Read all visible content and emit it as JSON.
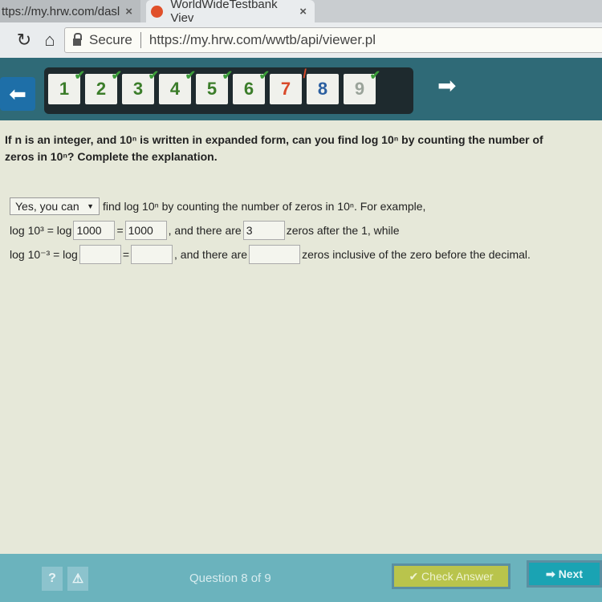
{
  "browser": {
    "tabs": [
      {
        "label": "ttps://my.hrw.com/dasl"
      },
      {
        "label": "WorldWideTestbank Viev"
      }
    ],
    "close_glyph": "×",
    "secure_label": "Secure",
    "url": "https://my.hrw.com/wwtb/api/viewer.pl"
  },
  "nav": {
    "back_glyph": "⬅",
    "forward_glyph": "➡",
    "questions": [
      {
        "num": "1",
        "state": "correct"
      },
      {
        "num": "2",
        "state": "correct"
      },
      {
        "num": "3",
        "state": "correct"
      },
      {
        "num": "4",
        "state": "correct"
      },
      {
        "num": "5",
        "state": "correct"
      },
      {
        "num": "6",
        "state": "correct"
      },
      {
        "num": "7",
        "state": "incorrect"
      },
      {
        "num": "8",
        "state": "current"
      },
      {
        "num": "9",
        "state": "correct"
      }
    ]
  },
  "question": {
    "text": "If n is an integer, and 10ⁿ is written in expanded form, can you find log 10ⁿ by counting the number of zeros in 10ⁿ? Complete the explanation."
  },
  "answer": {
    "select_value": "Yes, you can",
    "select_arrow": "▼",
    "line1_text": "find log 10ⁿ by counting the number of zeros in 10ⁿ. For example,",
    "line2_prefix": "log 10³ = log",
    "field1": "1000",
    "eq": "=",
    "field2": "1000",
    "line2_mid": ", and there are",
    "field3": "3",
    "line2_suffix": "zeros after the 1, while",
    "line3_prefix": "log 10⁻³ = log",
    "field4": "",
    "field5": "",
    "line3_mid": ", and there are",
    "field6": "",
    "line3_suffix": "zeros inclusive of the zero before the decimal."
  },
  "footer": {
    "help": "?",
    "warn": "⚠",
    "counter": "Question 8 of 9",
    "check_label": "✔ Check Answer",
    "next_label": "Next",
    "next_icon": "➡"
  }
}
